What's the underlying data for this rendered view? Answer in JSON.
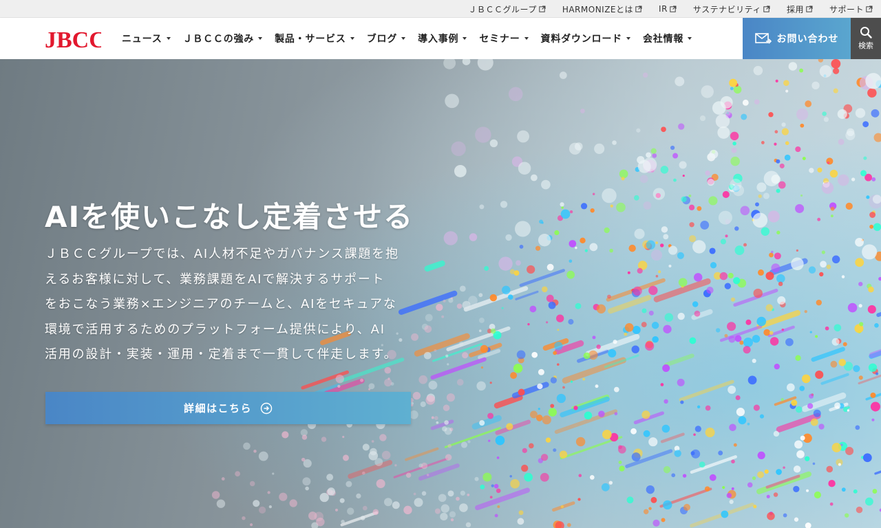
{
  "utility": {
    "links": [
      {
        "label": "ＪＢＣＣグループ",
        "icon": "external-link-icon"
      },
      {
        "label": "HARMONIZEとは",
        "icon": "external-link-icon"
      },
      {
        "label": "IR",
        "icon": "external-link-icon"
      },
      {
        "label": "サステナビリティ",
        "icon": "external-link-icon"
      },
      {
        "label": "採用",
        "icon": "external-link-icon"
      },
      {
        "label": "サポート",
        "icon": "external-link-icon"
      }
    ]
  },
  "header": {
    "logo_text": "JBCC",
    "brand_color": "#e2182e",
    "nav": [
      {
        "label": "ニュース"
      },
      {
        "label": "ＪＢＣＣの強み"
      },
      {
        "label": "製品・サービス"
      },
      {
        "label": "ブログ"
      },
      {
        "label": "導入事例"
      },
      {
        "label": "セミナー"
      },
      {
        "label": "資料ダウンロード"
      },
      {
        "label": "会社情報"
      }
    ],
    "contact_label": "お問い合わせ",
    "search_label": "検索"
  },
  "hero": {
    "title": "AIを使いこなし定着させる",
    "lines": [
      "ＪＢＣＣグループでは、AI人材不足やガバナンス課題を抱",
      "えるお客様に対して、業務課題をAIで解決するサポート",
      "をおこなう業務×エンジニアのチームと、AIをセキュアな",
      "環境で活用するためのプラットフォーム提供により、AI",
      "活用の設計・実装・運用・定着まで一貫して伴走します。"
    ],
    "cta_label": "詳細はこちら"
  }
}
